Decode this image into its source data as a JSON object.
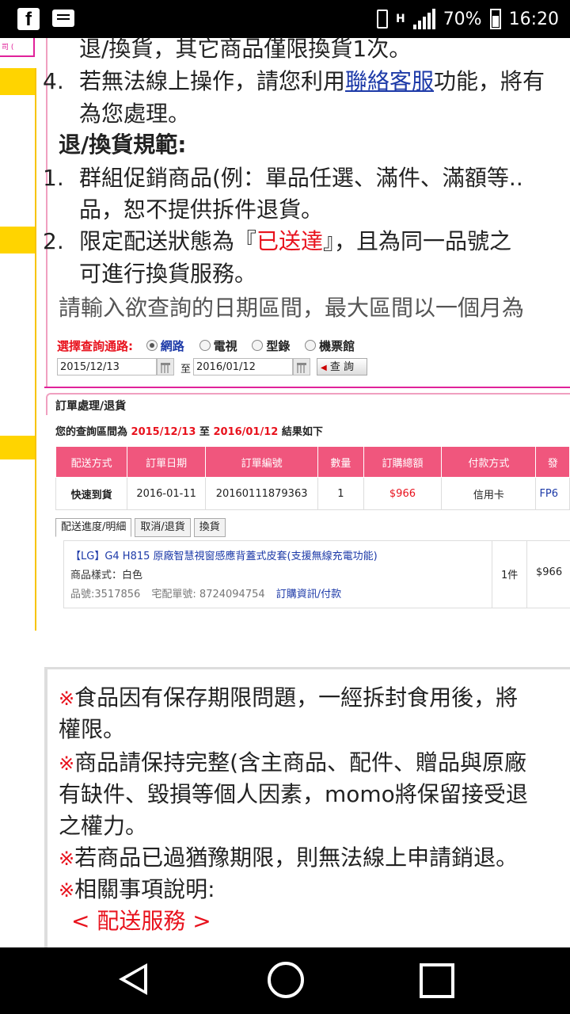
{
  "status_bar": {
    "battery_percent": "70%",
    "time": "16:20"
  },
  "left_panel": {
    "top_label": "司 ("
  },
  "content": {
    "line1": "退/換貨，其它商品僅限換貨1次。",
    "item4_num": "4.",
    "item4_text_a": "若無法線上操作，請您利用",
    "item4_link": "聯絡客服",
    "item4_text_b": "功能，將有",
    "item4_cont": "為您處理。",
    "rules_title": "退/換貨規範:",
    "rule1_num": "1.",
    "rule1_text": "群組促銷商品(例：單品任選、滿件、滿額等..",
    "rule1_cont": "品，恕不提供拆件退貨。",
    "rule2_num": "2.",
    "rule2_text_a": "限定配送狀態為『",
    "rule2_highlight": "已送達",
    "rule2_text_b": "』，且為同一品號之",
    "rule2_cont": "可進行換貨服務。",
    "query_prompt": "請輸入欲查詢的日期區間，最大區間以一個月為"
  },
  "query_form": {
    "label": "選擇查詢通路:",
    "channels": [
      "網路",
      "電視",
      "型錄",
      "機票館"
    ],
    "selected_channel": "網路",
    "start_date": "2015/12/13",
    "to_label": "至",
    "end_date": "2016/01/12",
    "query_button": "查 詢"
  },
  "order_section": {
    "title": "訂單處理/退貨",
    "range_prefix": "您的查詢區間為 ",
    "range_start": "2015/12/13",
    "range_mid": " 至 ",
    "range_end": "2016/01/12",
    "range_suffix": " 結果如下",
    "headers": [
      "配送方式",
      "訂單日期",
      "訂單編號",
      "數量",
      "訂購總額",
      "付款方式",
      "發"
    ],
    "row": {
      "delivery": "快速到貨",
      "date": "2016-01-11",
      "order_no": "20160111879363",
      "qty": "1",
      "total": "$966",
      "payment": "信用卡",
      "invoice": "FP6"
    },
    "tabs": [
      "配送進度/明細",
      "取消/退貨",
      "換貨"
    ],
    "item": {
      "title": "【LG】G4 H815 原廠智慧視窗感應背蓋式皮套(支援無線充電功能)",
      "style": "商品樣式：白色",
      "product_no": "品號:3517856",
      "tracking": "宅配單號: 8724094754",
      "info_link": "訂購資訊/付款",
      "qty": "1件",
      "amount": "$966"
    }
  },
  "notes": {
    "mark": "※",
    "n1_a": "食品因有保存期限問題，一經拆封食用後，將",
    "n1_b": "權限。",
    "n2_a": "商品請保持完整(含主商品、配件、贈品與原廠",
    "n2_b": "有缺件、毀損等個人因素，momo將保留接受退",
    "n2_c": "之權力。",
    "n3": "若商品已過猶豫期限，則無法線上申請銷退。",
    "n4": "相關事項說明:",
    "delivery_link": "< 配送服務 >"
  },
  "colors": {
    "accent_pink": "#e0229a",
    "table_header": "#f0567d",
    "link_blue": "#1d3aa8",
    "alert_red": "#e8121d",
    "sidebar_yellow": "#ffd400"
  }
}
